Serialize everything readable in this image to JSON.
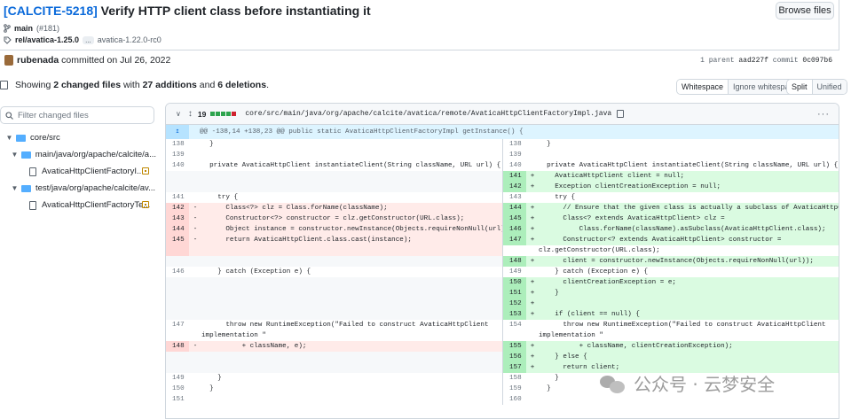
{
  "commit": {
    "issue": "[CALCITE-5218]",
    "title": " Verify HTTP client class before instantiating it",
    "browse_label": "Browse files",
    "branch": "main",
    "pr": "(#181)",
    "tag": "rel/avatica-1.25.0",
    "ellipsis": "...",
    "tag_prev": "avatica-1.22.0-rc0",
    "author": "rubenada",
    "authored": " committed on Jul 26, 2022",
    "parent_label": "1 parent ",
    "parent_hash": "aad227f",
    "commit_label": "  commit ",
    "commit_hash": "0c097b6"
  },
  "summary": {
    "prefix": "Showing ",
    "files": "2 changed files",
    "mid": " with ",
    "additions": "27 additions",
    "and": " and ",
    "deletions": "6 deletions",
    "end": ".",
    "whitespace": "Whitespace",
    "ignore_ws": "Ignore whitespace",
    "split": "Split",
    "unified": "Unified"
  },
  "sidebar": {
    "filter_placeholder": "Filter changed files",
    "nodes": [
      {
        "label": "core/src"
      },
      {
        "label": "main/java/org/apache/calcite/a..."
      },
      {
        "label": "AvaticaHttpClientFactoryI..."
      },
      {
        "label": "test/java/org/apache/calcite/av..."
      },
      {
        "label": "AvaticaHttpClientFactoryTe..."
      }
    ]
  },
  "file": {
    "count": "19",
    "path": "core/src/main/java/org/apache/calcite/avatica/remote/AvaticaHttpClientFactoryImpl.java",
    "more": "···",
    "hunk": "@@ -138,14 +138,23 @@ public static AvaticaHttpClientFactoryImpl getInstance() {",
    "colors": {
      "add": "#2da44e",
      "del": "#cf222e",
      "neutral": "#d0d7de"
    }
  },
  "diff_rows": [
    {
      "t": "ctx",
      "l": "138",
      "lc": "  }",
      "r": "138",
      "rc": "  }"
    },
    {
      "t": "ctx",
      "l": "139",
      "lc": "",
      "r": "139",
      "rc": ""
    },
    {
      "t": "ctx",
      "l": "140",
      "lc": "  private AvaticaHttpClient instantiateClient(String className, URL url) {",
      "r": "140",
      "rc": "  private AvaticaHttpClient instantiateClient(String className, URL url) {"
    },
    {
      "t": "addonly",
      "r": "141",
      "rc": "    AvaticaHttpClient client = null;"
    },
    {
      "t": "addonly",
      "r": "142",
      "rc": "    Exception clientCreationException = null;"
    },
    {
      "t": "ctx",
      "l": "141",
      "lc": "    try {",
      "r": "143",
      "rc": "    try {"
    },
    {
      "t": "chg",
      "l": "142",
      "lc": "      Class<?> clz = Class.forName(className);",
      "r": "144",
      "rc": "      // Ensure that the given class is actually a subclass of AvaticaHttpClient"
    },
    {
      "t": "chg",
      "l": "143",
      "lc": "      Constructor<?> constructor = clz.getConstructor(URL.class);",
      "r": "145",
      "rc": "      Class<? extends AvaticaHttpClient> clz ="
    },
    {
      "t": "chg",
      "l": "144",
      "lc": "      Object instance = constructor.newInstance(Objects.requireNonNull(url));",
      "r": "146",
      "rc": "          Class.forName(className).asSubclass(AvaticaHttpClient.class);"
    },
    {
      "t": "chg",
      "l": "145",
      "lc": "      return AvaticaHttpClient.class.cast(instance);",
      "r": "147",
      "rc": "      Constructor<? extends AvaticaHttpClient> constructor ="
    },
    {
      "t": "addcont",
      "rc": "clz.getConstructor(URL.class);"
    },
    {
      "t": "addd",
      "r": "148",
      "rc": "      client = constructor.newInstance(Objects.requireNonNull(url));"
    },
    {
      "t": "ctx",
      "l": "146",
      "lc": "    } catch (Exception e) {",
      "r": "149",
      "rc": "    } catch (Exception e) {"
    },
    {
      "t": "addonly",
      "r": "150",
      "rc": "      clientCreationException = e;"
    },
    {
      "t": "addonly",
      "r": "151",
      "rc": "    }"
    },
    {
      "t": "addonly",
      "r": "152",
      "rc": ""
    },
    {
      "t": "addonly",
      "r": "153",
      "rc": "    if (client == null) {"
    },
    {
      "t": "ctx",
      "l": "147",
      "lc": "      throw new RuntimeException(\"Failed to construct AvaticaHttpClient",
      "r": "154",
      "rc": "      throw new RuntimeException(\"Failed to construct AvaticaHttpClient"
    },
    {
      "t": "ctxcont",
      "lc": "implementation \"",
      "rc": "implementation \""
    },
    {
      "t": "chg",
      "l": "148",
      "lc": "          + className, e);",
      "r": "155",
      "rc": "          + className, clientCreationException);"
    },
    {
      "t": "addonly",
      "r": "156",
      "rc": "    } else {"
    },
    {
      "t": "addonly",
      "r": "157",
      "rc": "      return client;"
    },
    {
      "t": "ctx",
      "l": "149",
      "lc": "    }",
      "r": "158",
      "rc": "    }"
    },
    {
      "t": "ctx",
      "l": "150",
      "lc": "  }",
      "r": "159",
      "rc": "  }"
    },
    {
      "t": "ctx",
      "l": "151",
      "lc": "",
      "r": "160",
      "rc": ""
    }
  ],
  "watermark": "公众号 · 云梦安全"
}
